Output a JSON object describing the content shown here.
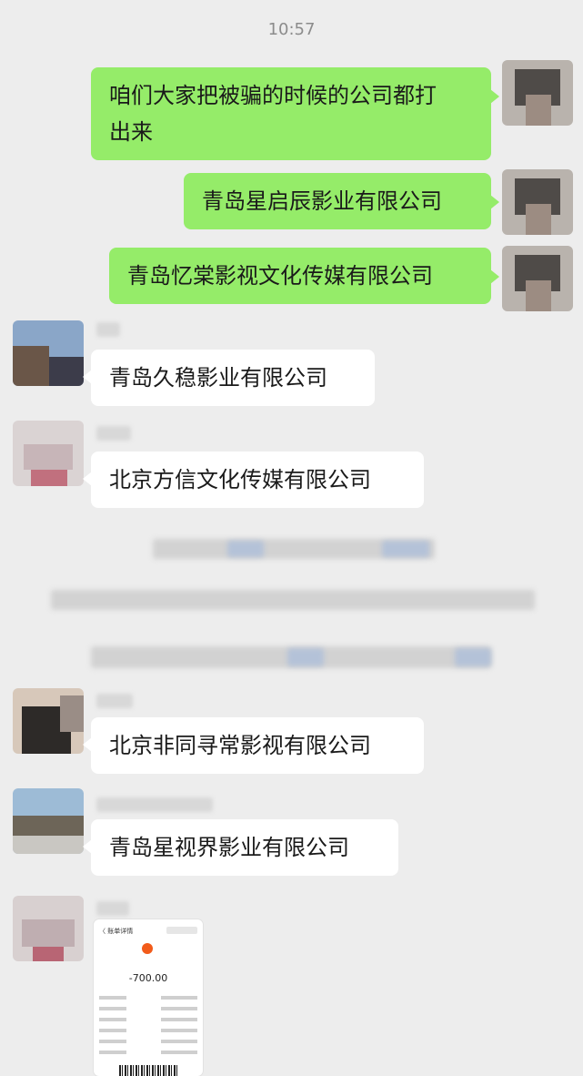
{
  "status": {
    "time": "10:57"
  },
  "messages": [
    {
      "sender": "me",
      "text_line1": "咱们大家把被骗的时候的公司都打",
      "text_line2": "出来"
    },
    {
      "sender": "me",
      "text": "青岛星启辰影业有限公司"
    },
    {
      "sender": "me",
      "text": "青岛忆棠影视文化传媒有限公司"
    },
    {
      "sender": "other",
      "text": "青岛久稳影业有限公司"
    },
    {
      "sender": "other",
      "text": "北京方信文化传媒有限公司"
    },
    {
      "sender": "other",
      "text": "北京非同寻常影视有限公司"
    },
    {
      "sender": "other",
      "text": "青岛星视界影业有限公司"
    }
  ],
  "receipt": {
    "header": "〈 账单详情",
    "amount": "-700.00",
    "accent_color": "#f25b1a"
  },
  "colors": {
    "background": "#ededed",
    "my_bubble": "#95ec69",
    "other_bubble": "#ffffff"
  }
}
